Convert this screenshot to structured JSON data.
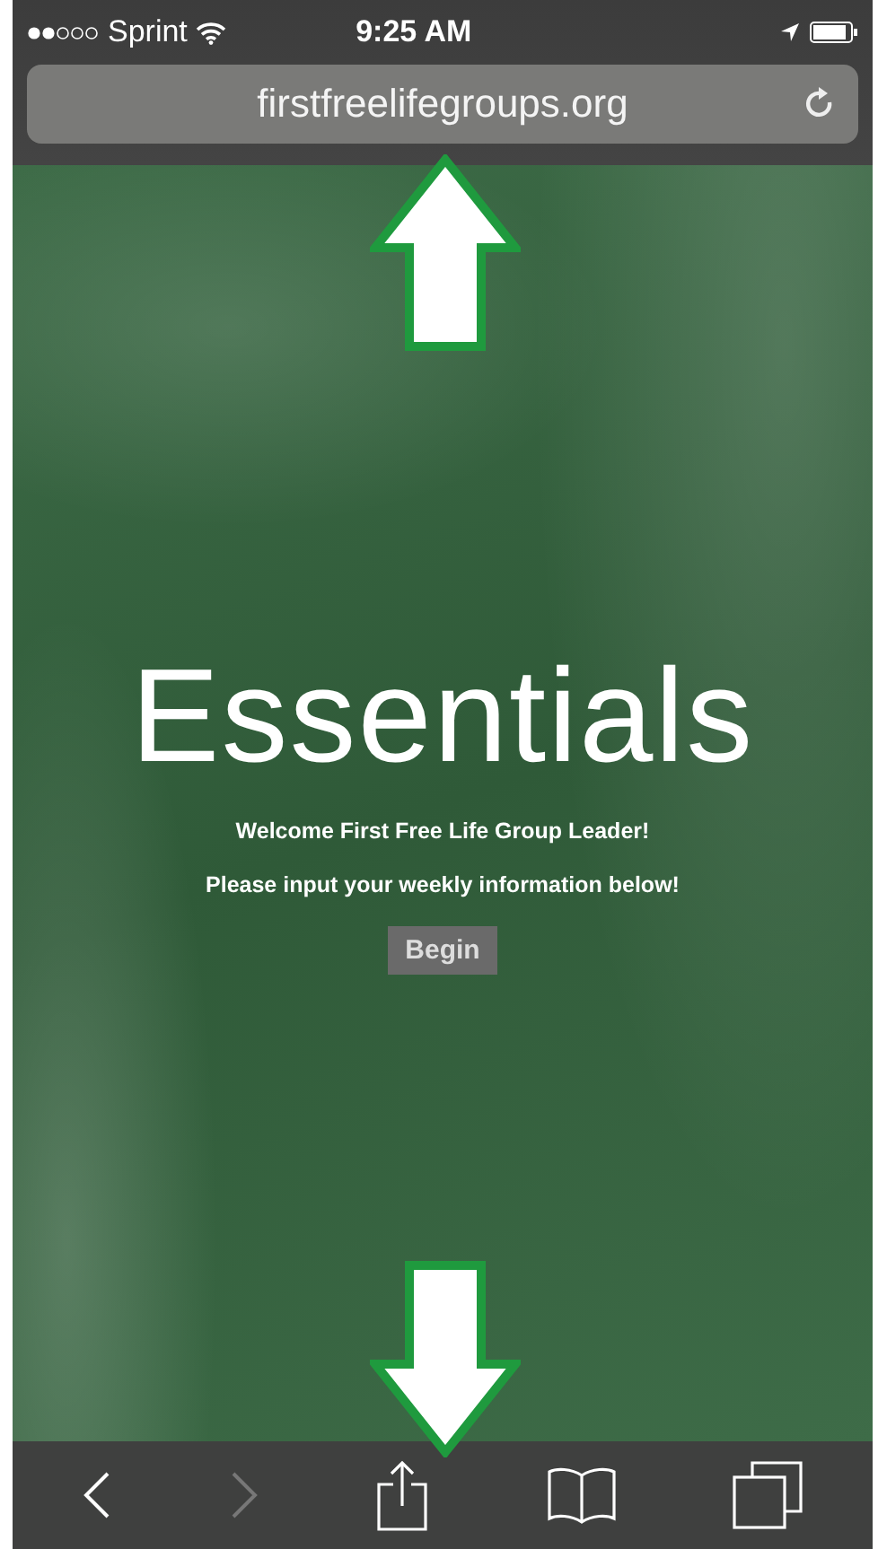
{
  "status_bar": {
    "carrier": "Sprint",
    "time": "9:25 AM"
  },
  "address_bar": {
    "url": "firstfreelifegroups.org"
  },
  "page": {
    "logo": "Essentials",
    "welcome": "Welcome First Free Life Group Leader!",
    "instruction": "Please input your weekly information below!",
    "button": "Begin"
  },
  "toolbar": [
    {
      "kind": "back",
      "disabled": false
    },
    {
      "kind": "forward",
      "disabled": true
    },
    {
      "kind": "share",
      "disabled": false
    },
    {
      "kind": "bookmarks",
      "disabled": false
    },
    {
      "kind": "tabs",
      "disabled": false
    }
  ],
  "annotations": [
    {
      "kind": "up"
    },
    {
      "kind": "down"
    }
  ]
}
